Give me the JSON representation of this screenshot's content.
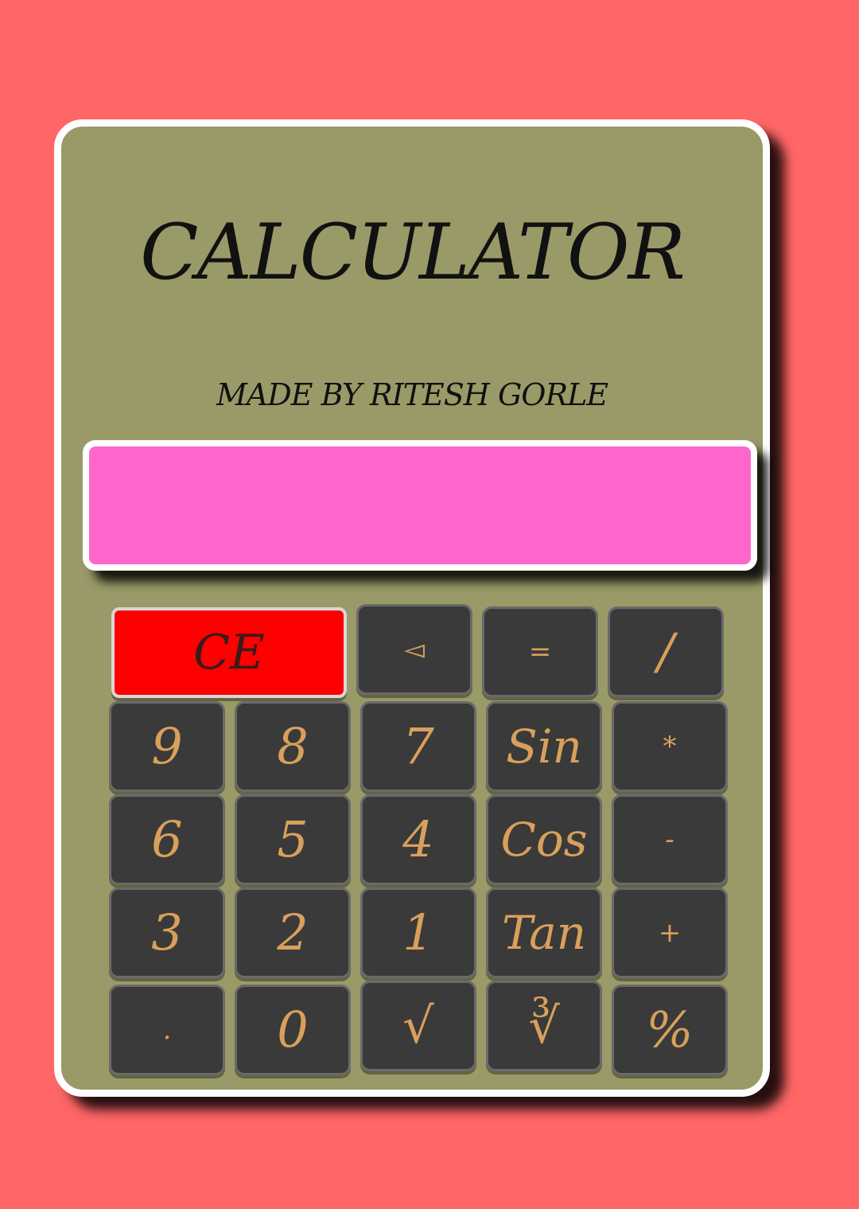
{
  "title": "CALCULATOR",
  "subtitle": "MADE BY RITESH GORLE",
  "display_value": "",
  "colors": {
    "background": "#ff6666",
    "body": "#9a9a68",
    "display": "#ff66cc",
    "key": "#3a3a3a",
    "key_text": "#d9a05b",
    "clear": "#ff0000"
  },
  "keys": {
    "clear": "CE",
    "backspace": "◅",
    "equals": "=",
    "divide": "/",
    "nine": "9",
    "eight": "8",
    "seven": "7",
    "sin": "Sin",
    "multiply": "*",
    "six": "6",
    "five": "5",
    "four": "4",
    "cos": "Cos",
    "subtract": "-",
    "three": "3",
    "two": "2",
    "one": "1",
    "tan": "Tan",
    "add": "+",
    "decimal": ".",
    "zero": "0",
    "sqrt": "√",
    "cbrt": "∛",
    "percent": "%"
  }
}
